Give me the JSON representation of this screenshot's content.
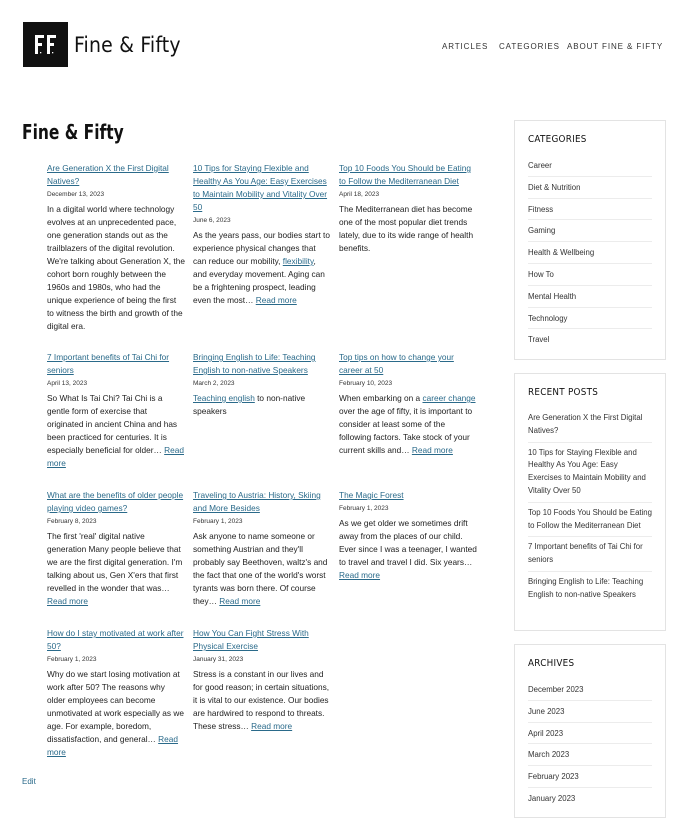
{
  "site": {
    "logo_text": "FF",
    "title": "Fine & Fifty"
  },
  "nav": [
    {
      "label": "ARTICLES"
    },
    {
      "label": "CATEGORIES"
    },
    {
      "label": "ABOUT FINE & FIFTY"
    }
  ],
  "page_title": "Fine & Fifty",
  "read_more": "Read more",
  "posts": [
    {
      "title": "Are Generation X the First Digital Natives?",
      "date": "December 13, 2023",
      "excerpt": "In a digital world where technology evolves at an unprecedented pace, one generation stands out as the trailblazers of the digital revolution. We're talking about Generation X, the cohort born roughly between the 1960s and 1980s, who had the unique experience of being the first to witness the birth and growth of the digital era."
    },
    {
      "title": "10 Tips for Staying Flexible and Healthy As You Age: Easy Exercises to Maintain Mobility and Vitality Over 50",
      "date": "June 6, 2023",
      "excerpt_before": "As the years pass, our bodies start to experience physical changes that can reduce our mobility, ",
      "excerpt_link": "flexibility",
      "excerpt_after": ", and everyday movement. Aging can be a frightening prospect, leading even the most…"
    },
    {
      "title": "Top 10 Foods You Should be Eating to Follow the Mediterranean Diet",
      "date": "April 18, 2023",
      "excerpt": "The Mediterranean diet has become one of the most popular diet trends lately, due to its wide range of health benefits."
    },
    {
      "title": "7 Important benefits of Tai Chi for seniors",
      "date": "April 13, 2023",
      "excerpt": "So What Is Tai Chi? Tai Chi is a gentle form of exercise that originated in ancient China and has been practiced for centuries. It is especially beneficial for older…"
    },
    {
      "title": "Bringing English to Life: Teaching English to non-native Speakers",
      "date": "March 2, 2023",
      "excerpt_link": "Teaching english",
      "excerpt_after": " to non-native speakers"
    },
    {
      "title": "Top tips on how to change your career at 50",
      "date": "February 10, 2023",
      "excerpt_before": "When embarking on a ",
      "excerpt_link": "career change",
      "excerpt_after": " over the age of fifty, it is important to consider at least some of the following factors. Take stock of your current skills and…"
    },
    {
      "title": "What are the benefits of older people playing video games?",
      "date": "February 8, 2023",
      "excerpt": "The first 'real' digital native generation Many people believe that we are the first digital generation. I'm talking about us, Gen X'ers that first revelled in the wonder that was…"
    },
    {
      "title": "Traveling to Austria: History, Skiing and More Besides",
      "date": "February 1, 2023",
      "excerpt": "Ask anyone to name someone or something Austrian and they'll probably say Beethoven, waltz's and the fact that one of the world's worst tyrants was born there. Of course they…"
    },
    {
      "title": "The Magic Forest",
      "date": "February 1, 2023",
      "excerpt": "As we get older we sometimes drift away from the places of our child. Ever since I was a teenager, I wanted to travel and travel I did. Six years…"
    },
    {
      "title": "How do I stay motivated at work after 50?",
      "date": "February 1, 2023",
      "excerpt": "Why do we start losing motivation at work after 50? The reasons why older employees can become unmotivated at work especially as we age. For example, boredom, dissatisfaction, and general…"
    },
    {
      "title": "How You Can Fight Stress With Physical Exercise",
      "date": "January 31, 2023",
      "excerpt": "Stress is a constant in our lives and for good reason; in certain situations, it is vital to our existence. Our bodies are hardwired to respond to threats. These stress…"
    }
  ],
  "sidebar": {
    "categories": {
      "heading": "CATEGORIES",
      "items": [
        "Career",
        "Diet & Nutrition",
        "Fitness",
        "Gaming",
        "Health & Wellbeing",
        "How To",
        "Mental Health",
        "Technology",
        "Travel"
      ]
    },
    "recent": {
      "heading": "RECENT POSTS",
      "items": [
        "Are Generation X the First Digital Natives?",
        "10 Tips for Staying Flexible and Healthy As You Age: Easy Exercises to Maintain Mobility and Vitality Over 50",
        "Top 10 Foods You Should be Eating to Follow the Mediterranean Diet",
        "7 Important benefits of Tai Chi for seniors",
        "Bringing English to Life: Teaching English to non-native Speakers"
      ]
    },
    "archives": {
      "heading": "ARCHIVES",
      "items": [
        "December 2023",
        "June 2023",
        "April 2023",
        "March 2023",
        "February 2023",
        "January 2023"
      ]
    }
  },
  "edit_label": "Edit",
  "colors": {
    "link": "#2a6a8a",
    "text": "#222222",
    "logo_bg": "#111111"
  }
}
